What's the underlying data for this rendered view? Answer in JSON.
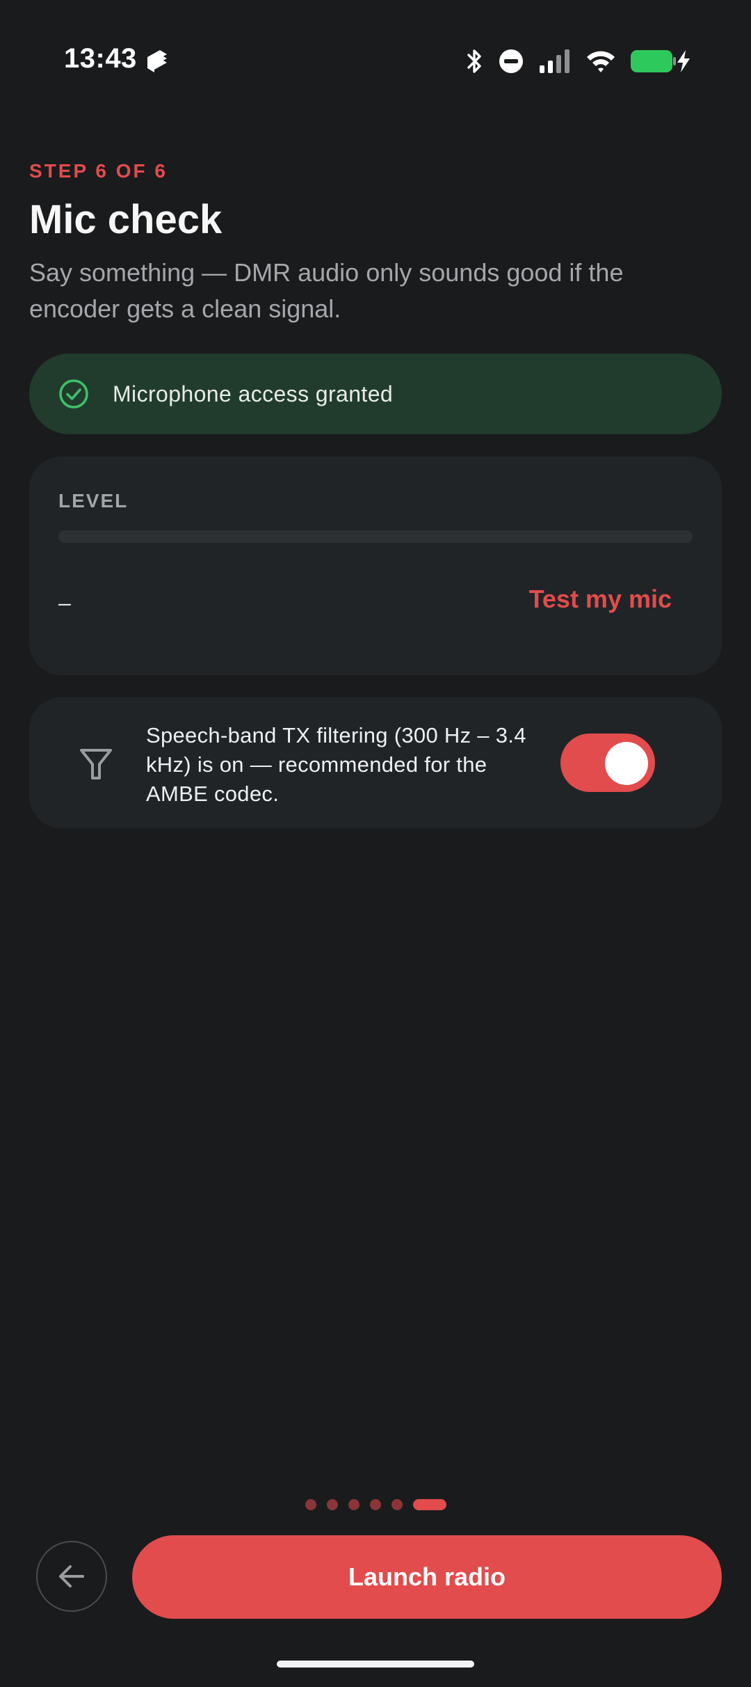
{
  "status_bar": {
    "time": "13:43",
    "battery_color": "#2ec95c",
    "icons": [
      "app-icon",
      "bluetooth-icon",
      "dnd-icon",
      "cellular-icon",
      "wifi-icon",
      "battery-icon",
      "charging-icon"
    ]
  },
  "header": {
    "step": "STEP 6 OF 6",
    "title": "Mic check",
    "subtitle": "Say something — DMR audio only sounds good if the encoder gets a clean signal."
  },
  "permission": {
    "text": "Microphone access granted",
    "icon": "check-circle-icon",
    "color": "#3fbf6a"
  },
  "level_card": {
    "label": "LEVEL",
    "level": 0,
    "value": "–",
    "test_button": "Test my mic"
  },
  "filter_card": {
    "icon": "filter-icon",
    "text": "Speech-band TX filtering (300 Hz – 3.4 kHz) is on — recommended for the AMBE codec.",
    "toggle_on": true
  },
  "pager": {
    "total": 6,
    "current": 6
  },
  "actions": {
    "back_icon": "arrow-left-icon",
    "primary": "Launch radio"
  },
  "colors": {
    "accent": "#e24c4c",
    "background": "#1a1b1d",
    "card": "#212427",
    "success_bg": "#213c2c"
  }
}
